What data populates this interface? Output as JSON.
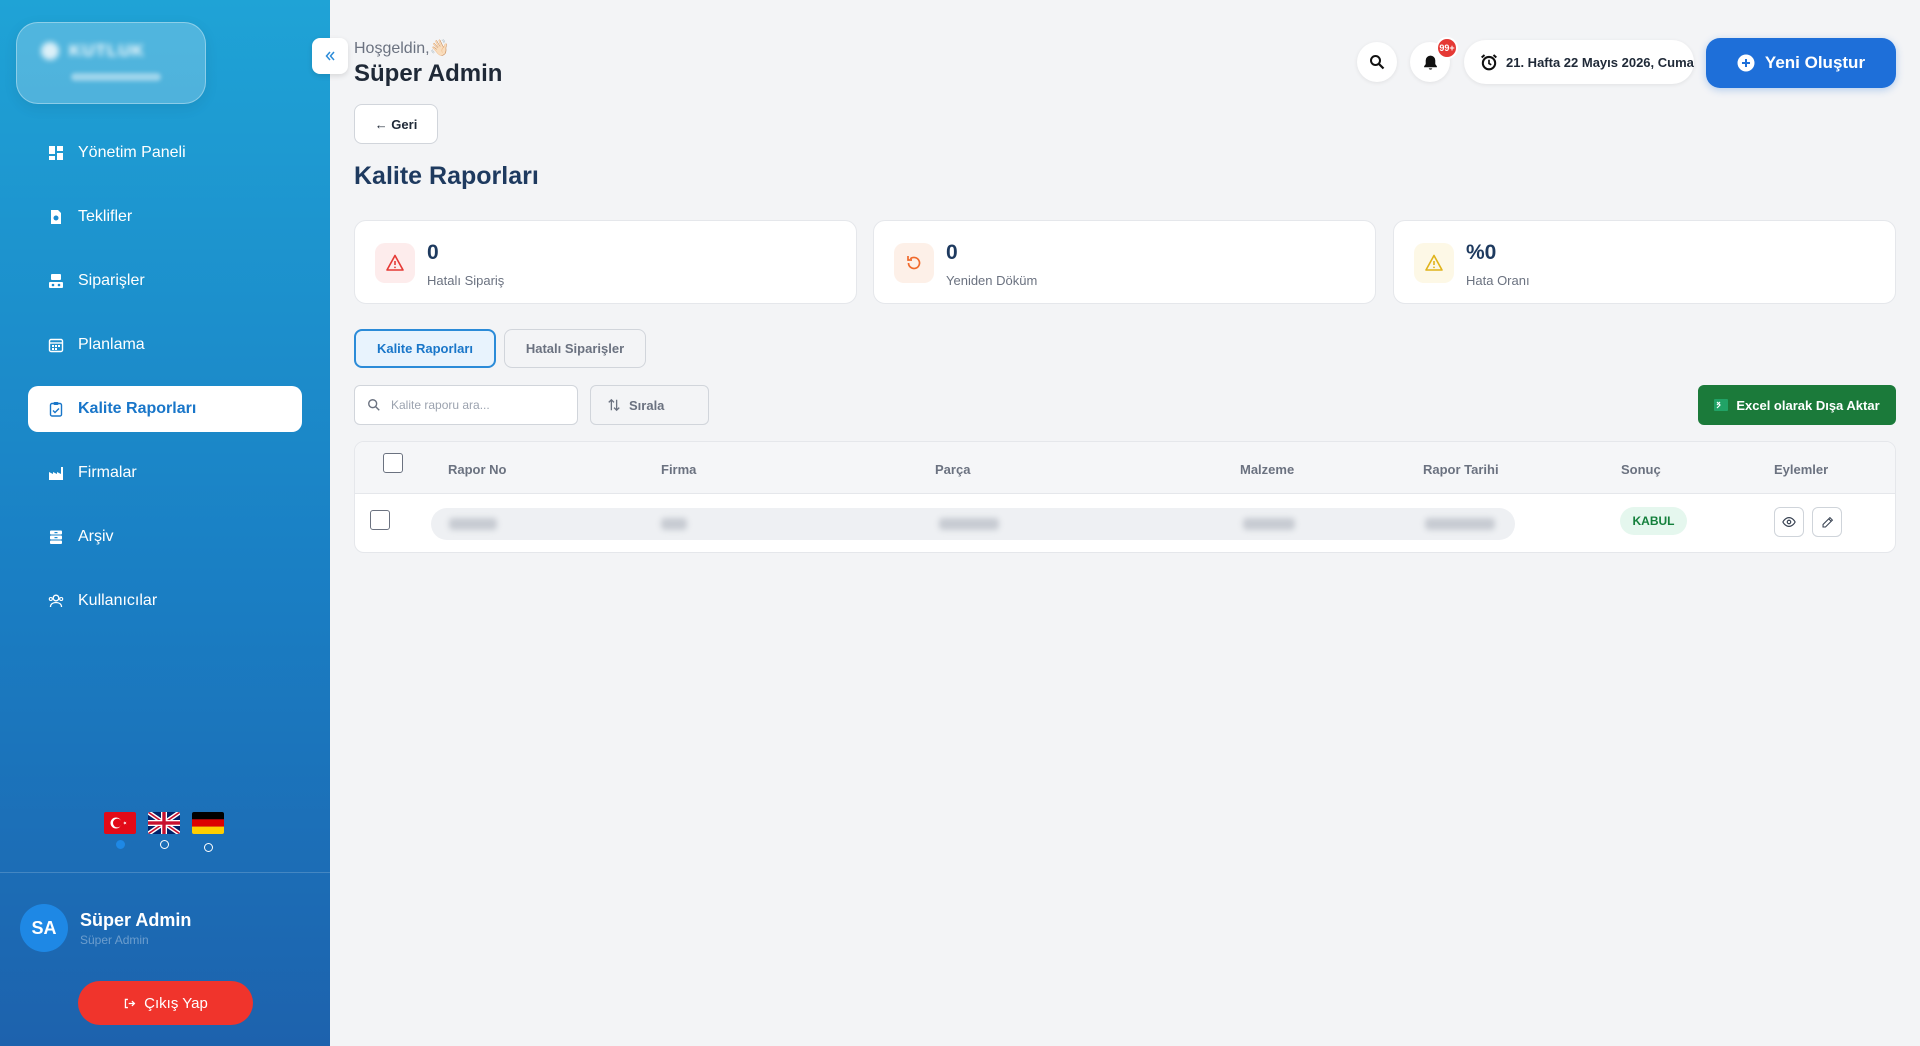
{
  "sidebar": {
    "logo_text": "KUTLUK",
    "items": [
      {
        "label": "Yönetim Paneli",
        "icon": "dashboard-icon"
      },
      {
        "label": "Teklifler",
        "icon": "document-icon"
      },
      {
        "label": "Siparişler",
        "icon": "orders-icon"
      },
      {
        "label": "Planlama",
        "icon": "calendar-icon"
      },
      {
        "label": "Kalite Raporları",
        "icon": "clipboard-check-icon",
        "active": true
      },
      {
        "label": "Firmalar",
        "icon": "factory-icon"
      },
      {
        "label": "Arşiv",
        "icon": "archive-icon"
      },
      {
        "label": "Kullanıcılar",
        "icon": "users-icon"
      }
    ],
    "languages": [
      {
        "code": "tr",
        "selected": true
      },
      {
        "code": "en",
        "selected": false
      },
      {
        "code": "de",
        "selected": false
      }
    ],
    "user": {
      "initials": "SA",
      "name": "Süper Admin",
      "role": "Süper Admin"
    },
    "logout_label": "Çıkış Yap"
  },
  "header": {
    "welcome": "Hoşgeldin,👋🏻",
    "user_name": "Süper Admin",
    "notification_badge": "99+",
    "date_text": "21. Hafta 22 Mayıs 2026, Cuma",
    "new_button": "Yeni Oluştur"
  },
  "back_label": "← Geri",
  "page_title": "Kalite Raporları",
  "stats": [
    {
      "value": "0",
      "label": "Hatalı Sipariş",
      "color": "#e53935"
    },
    {
      "value": "0",
      "label": "Yeniden Döküm",
      "color": "#f06a2c"
    },
    {
      "value": "%0",
      "label": "Hata Oranı",
      "color": "#e0b31a"
    }
  ],
  "tabs": [
    {
      "label": "Kalite Raporları",
      "active": true
    },
    {
      "label": "Hatalı Siparişler",
      "active": false
    }
  ],
  "toolbar": {
    "search_placeholder": "Kalite raporu ara...",
    "sort_label": "Sırala",
    "excel_label": "Excel olarak Dışa Aktar"
  },
  "table": {
    "columns": [
      "Rapor No",
      "Firma",
      "Parça",
      "Malzeme",
      "Rapor Tarihi",
      "Sonuç",
      "Eylemler"
    ],
    "rows": [
      {
        "result": "KABUL"
      }
    ]
  },
  "colors": {
    "accent": "#1e6fd9",
    "danger": "#f0342c",
    "success": "#1b7a3a"
  }
}
